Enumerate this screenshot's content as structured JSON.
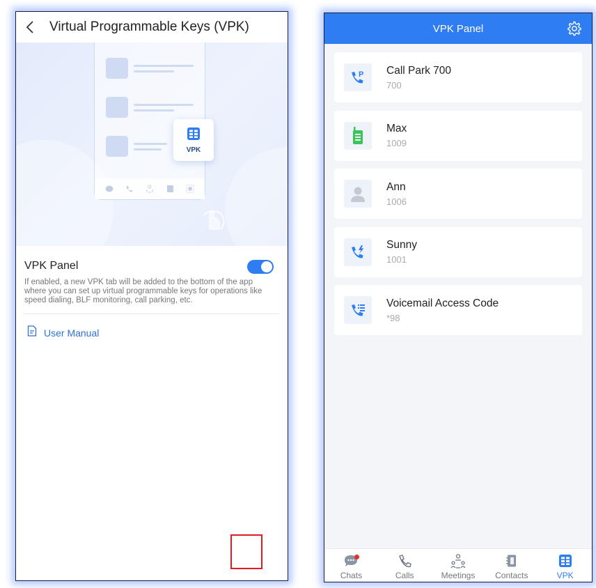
{
  "settings_screen": {
    "title": "Virtual Programmable Keys (VPK)",
    "illustration": {
      "card_label": "VPK"
    },
    "vpk_panel": {
      "label": "VPK Panel",
      "enabled": true,
      "description": "If enabled, a new VPK tab will be added to the bottom of the app where you can set up virtual programmable keys for operations like speed dialing, BLF monitoring, call parking, etc."
    },
    "user_manual": {
      "label": "User Manual"
    }
  },
  "vpk_screen": {
    "title": "VPK Panel",
    "items": [
      {
        "name": "Call Park 700",
        "ext": "700",
        "icon": "call-park-icon"
      },
      {
        "name": "Max",
        "ext": "1009",
        "icon": "walkie-talkie-icon"
      },
      {
        "name": "Ann",
        "ext": "1006",
        "icon": "person-icon"
      },
      {
        "name": "Sunny",
        "ext": "1001",
        "icon": "speed-dial-icon"
      },
      {
        "name": "Voicemail Access Code",
        "ext": "*98",
        "icon": "voicemail-list-icon"
      }
    ],
    "tabs": [
      {
        "label": "Chats",
        "icon": "chat-icon",
        "badge": true
      },
      {
        "label": "Calls",
        "icon": "phone-icon"
      },
      {
        "label": "Meetings",
        "icon": "meetings-icon"
      },
      {
        "label": "Contacts",
        "icon": "contacts-icon"
      },
      {
        "label": "VPK",
        "icon": "vpk-icon",
        "active": true
      }
    ]
  },
  "colors": {
    "accent": "#2f7df2",
    "highlight": "#e31b23",
    "green": "#3cc45a"
  }
}
